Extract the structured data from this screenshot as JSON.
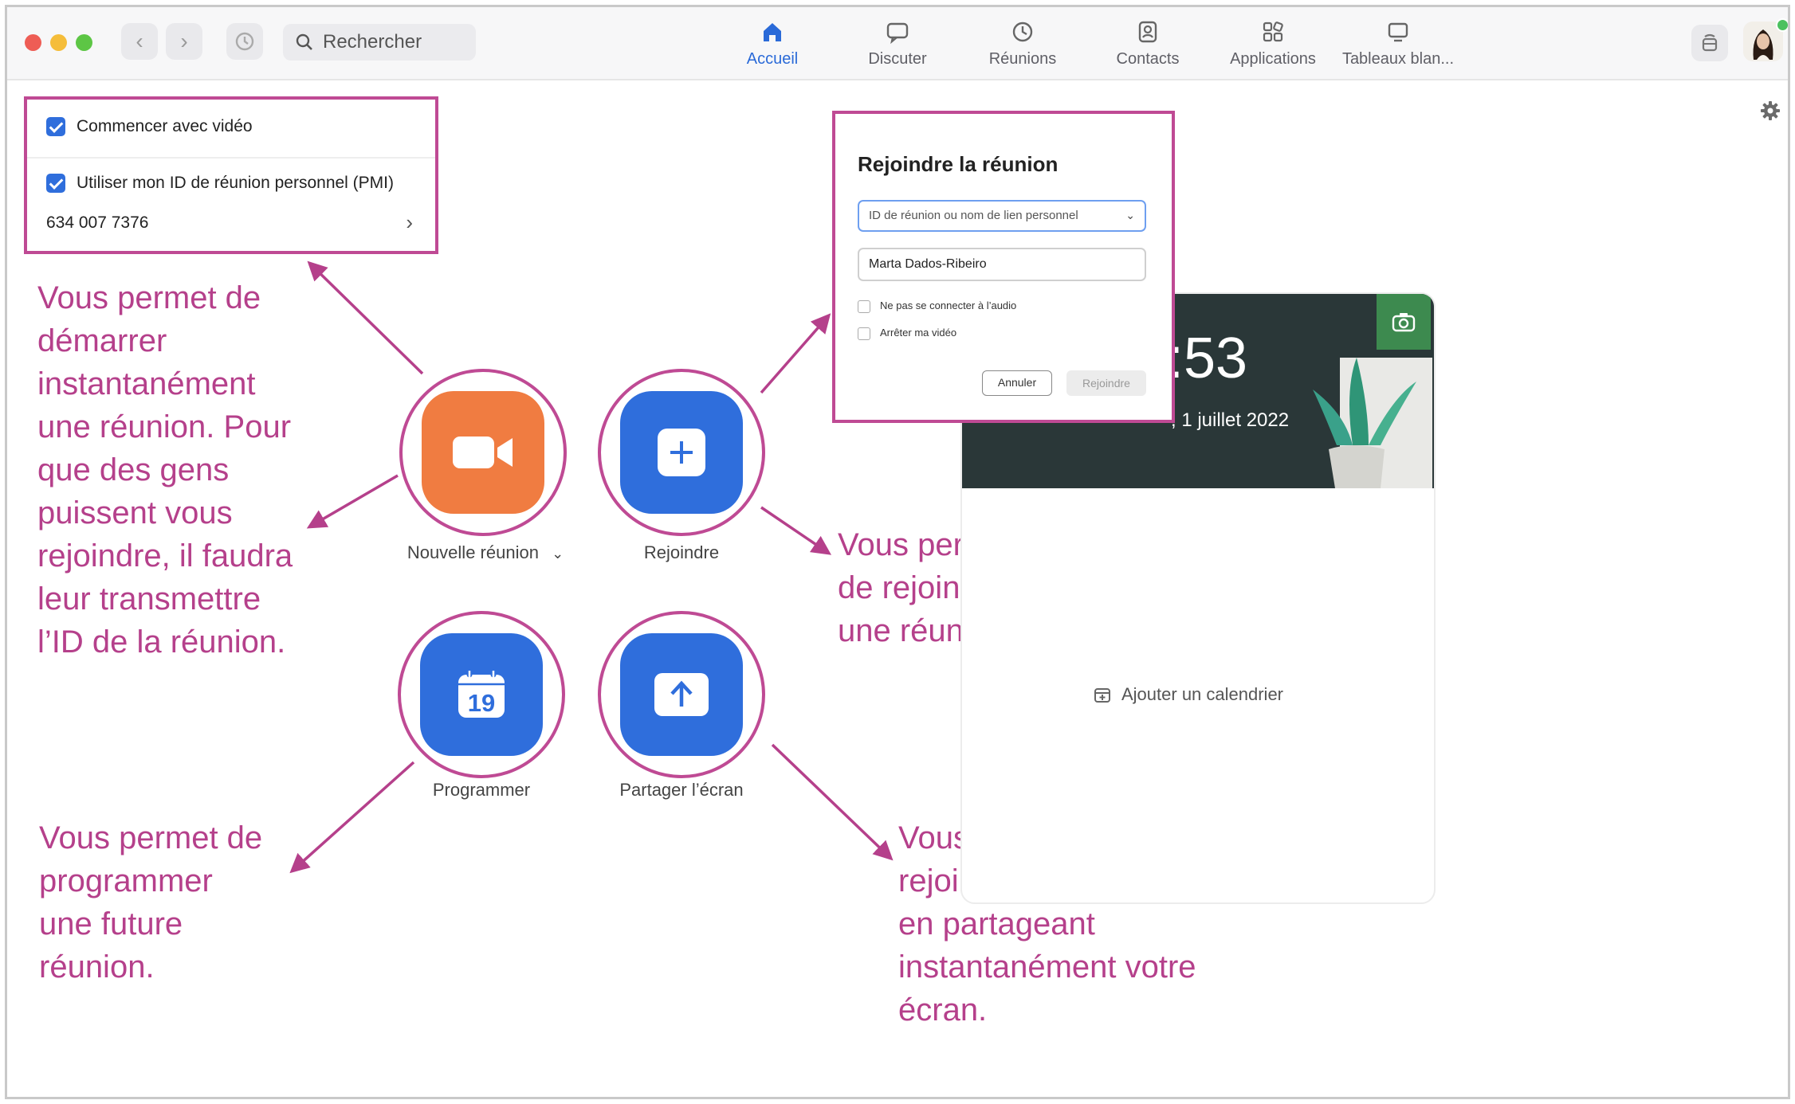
{
  "titlebar": {
    "search_placeholder": "Rechercher",
    "tabs": [
      {
        "label": "Accueil",
        "icon": "home-icon",
        "active": true
      },
      {
        "label": "Discuter",
        "icon": "chat-icon",
        "active": false
      },
      {
        "label": "Réunions",
        "icon": "clock-icon",
        "active": false
      },
      {
        "label": "Contacts",
        "icon": "contacts-icon",
        "active": false
      },
      {
        "label": "Applications",
        "icon": "apps-icon",
        "active": false
      },
      {
        "label": "Tableaux blan...",
        "icon": "whiteboard-icon",
        "active": false
      }
    ],
    "accent_color": "#2a6ad8"
  },
  "options_panel": {
    "start_video_label": "Commencer avec vidéo",
    "pmi_label": "Utiliser mon ID de réunion personnel (PMI)",
    "pmi_value": "634 007 7376"
  },
  "actions": {
    "new_meeting": "Nouvelle réunion",
    "join": "Rejoindre",
    "schedule": "Programmer",
    "schedule_day": "19",
    "share_screen": "Partager l’écran"
  },
  "join_dialog": {
    "title": "Rejoindre la réunion",
    "id_placeholder": "ID de réunion ou nom de lien personnel",
    "name_value": "Marta Dados-Ribeiro",
    "no_audio_label": "Ne pas se connecter à l’audio",
    "stop_video_label": "Arrêter ma vidéo",
    "cancel_label": "Annuler",
    "join_label": "Rejoindre"
  },
  "calendar_card": {
    "time": ":53",
    "date": ", 1 juillet 2022",
    "add_calendar_label": "Ajouter un calendrier"
  },
  "annotations": {
    "new_meeting": [
      "Vous permet de",
      "démarrer",
      "instantanément",
      "une réunion. Pour",
      "que des gens",
      "puissent vous",
      "rejoindre, il faudra",
      "leur transmettre",
      "l’ID de la réunion."
    ],
    "join": [
      "Vous permet",
      "de rejoindre",
      "une réunion."
    ],
    "schedule": [
      "Vous permet de",
      "programmer",
      "une future",
      "réunion."
    ],
    "share": [
      "Vous permet de",
      "rejoindre une réunion",
      "en partageant",
      "instantanément votre",
      "écran."
    ],
    "color": "#b5408b"
  }
}
